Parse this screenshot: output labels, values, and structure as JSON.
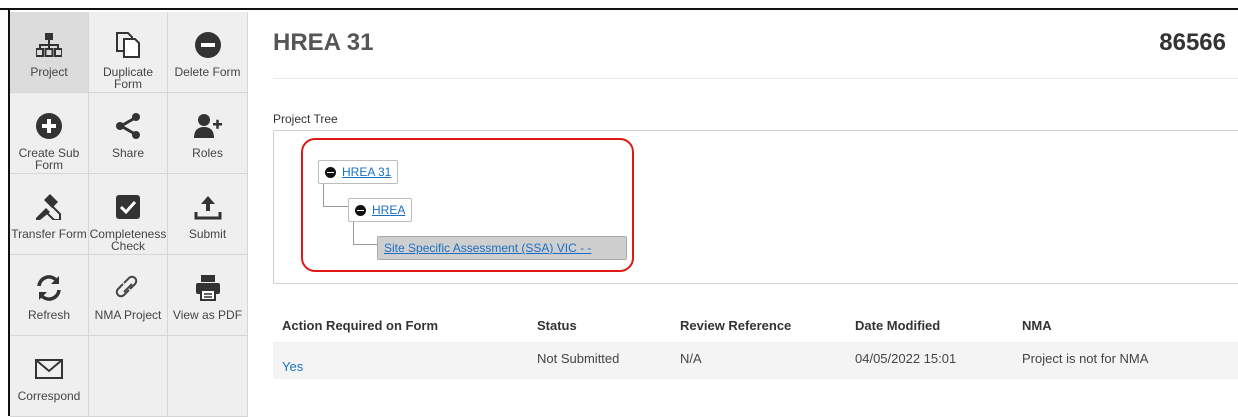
{
  "tools": [
    {
      "name": "project-button",
      "icon": "sitemap-icon",
      "label": "Project",
      "active": true
    },
    {
      "name": "duplicate-form-button",
      "icon": "duplicate-icon",
      "label": "Duplicate\nForm"
    },
    {
      "name": "delete-form-button",
      "icon": "minus-circle-icon",
      "label": "Delete Form"
    },
    {
      "name": "create-sub-form-button",
      "icon": "plus-circle-icon",
      "label": "Create Sub\nForm"
    },
    {
      "name": "share-button",
      "icon": "share-icon",
      "label": "Share"
    },
    {
      "name": "roles-button",
      "icon": "user-plus-icon",
      "label": "Roles"
    },
    {
      "name": "transfer-form-button",
      "icon": "transfer-icon",
      "label": "Transfer Form"
    },
    {
      "name": "completeness-check-button",
      "icon": "checkbox-icon",
      "label": "Completeness\nCheck"
    },
    {
      "name": "submit-button",
      "icon": "upload-icon",
      "label": "Submit"
    },
    {
      "name": "refresh-button",
      "icon": "refresh-icon",
      "label": "Refresh"
    },
    {
      "name": "nma-project-button",
      "icon": "link-icon",
      "label": "NMA Project"
    },
    {
      "name": "view-as-pdf-button",
      "icon": "printer-icon",
      "label": "View as PDF"
    },
    {
      "name": "correspond-button",
      "icon": "envelope-icon",
      "label": "Correspond"
    }
  ],
  "header": {
    "title": "HREA 31",
    "number": "86566"
  },
  "tree": {
    "label": "Project Tree",
    "nodes": [
      "HREA 31",
      "HREA",
      "Site Specific Assessment (SSA) VIC - -"
    ]
  },
  "table": {
    "headers": [
      "Action Required on Form",
      "Status",
      "Review Reference",
      "Date Modified",
      "NMA"
    ],
    "row": [
      "Yes",
      "Not Submitted",
      "N/A",
      "04/05/2022 15:01",
      "Project is not for NMA"
    ]
  },
  "colors": {
    "link": "#1a6fc4",
    "highlight": "#e01818",
    "panel": "#efefef"
  }
}
